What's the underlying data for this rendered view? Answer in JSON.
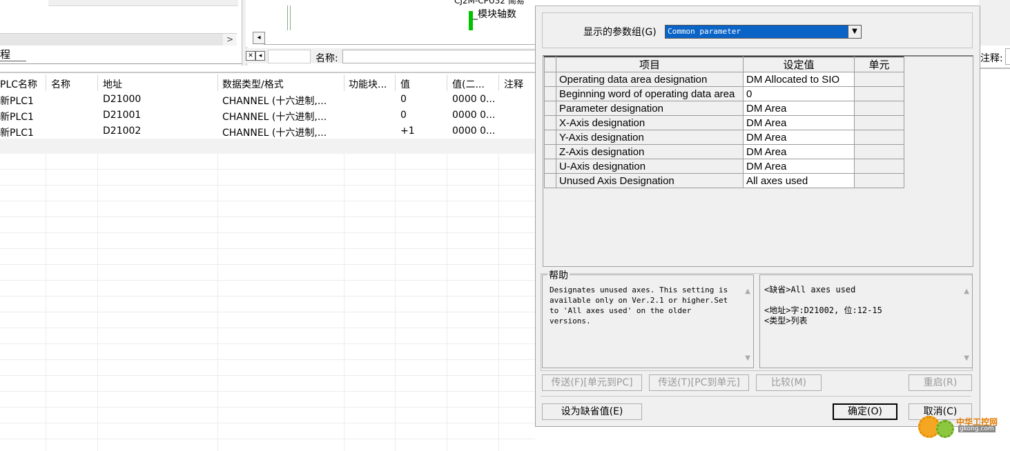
{
  "background": {
    "tab_label": "程",
    "cpu_label": "CJ2M-CPU32 简易",
    "axis_label": "_模块轴数",
    "name_label": "名称:",
    "note_label": "注释:",
    "scroll_right_arrow": ">",
    "scroll_left_arrow": "◂",
    "watch_columns": [
      "PLC名称",
      "名称",
      "地址",
      "数据类型/格式",
      "功能块...",
      "值",
      "值(二...",
      "注释"
    ],
    "watch_rows": [
      [
        "新PLC1",
        "",
        "D21000",
        "CHANNEL (十六进制,...",
        "",
        "0",
        "0000 0...",
        ""
      ],
      [
        "新PLC1",
        "",
        "D21001",
        "CHANNEL (十六进制,...",
        "",
        "0",
        "0000 0...",
        ""
      ],
      [
        "新PLC1",
        "",
        "D21002",
        "CHANNEL (十六进制,...",
        "",
        "+1",
        "0000 0...",
        ""
      ]
    ]
  },
  "dialog": {
    "param_group_label": "显示的参数组(G)",
    "param_group_value": "Common parameter",
    "table_headers": {
      "item": "项目",
      "value": "设定值",
      "unit": "单元"
    },
    "params": [
      {
        "item": "Operating data area designation",
        "value": "DM Allocated to SIO",
        "unit": ""
      },
      {
        "item": "Beginning word of operating data area",
        "value": "0",
        "unit": ""
      },
      {
        "item": "Parameter designation",
        "value": "DM Area",
        "unit": ""
      },
      {
        "item": "X-Axis designation",
        "value": "DM Area",
        "unit": ""
      },
      {
        "item": "Y-Axis designation",
        "value": "DM Area",
        "unit": ""
      },
      {
        "item": "Z-Axis designation",
        "value": "DM Area",
        "unit": ""
      },
      {
        "item": "U-Axis designation",
        "value": "DM Area",
        "unit": ""
      },
      {
        "item": "Unused Axis Designation",
        "value": "All axes used",
        "unit": ""
      }
    ],
    "help_label": "帮助",
    "help_text": "Designates unused axes. This setting is available only on Ver.2.1 or higher.Set to 'All axes used' on the older versions.",
    "help_default": "<缺省>All axes used",
    "help_address": "<地址>字:D21002, 位:12-15",
    "help_type": "<类型>列表",
    "buttons": {
      "transfer_unit_to_pc": "传送(F)[单元到PC]",
      "transfer_pc_to_unit": "传送(T)[PC到单元]",
      "compare": "比较(M)",
      "restart": "重启(R)",
      "set_default": "设为缺省值(E)",
      "ok": "确定(O)",
      "cancel": "取消(C)"
    }
  },
  "watermark": {
    "cn": "中华工控网",
    "en": "gkong.com"
  },
  "colors": {
    "select_highlight": "#0a64c8",
    "dialog_bg": "#f0f0f0",
    "green_bar": "#00c000"
  }
}
